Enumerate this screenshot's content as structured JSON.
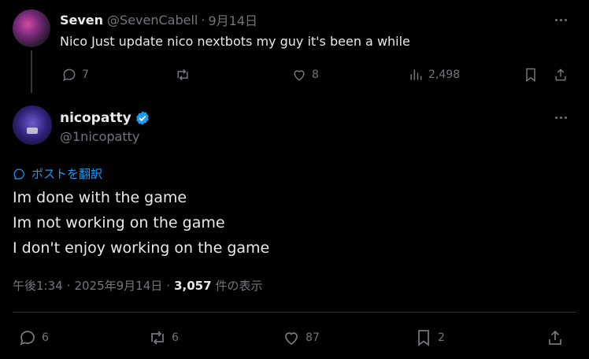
{
  "reply": {
    "name": "Seven",
    "handle": "@SevenCabell",
    "separator": "·",
    "date": "9月14日",
    "text": "Nico Just update nico nextbots my guy it's been a while",
    "actions": {
      "replies": "7",
      "reposts": "",
      "likes": "8",
      "views": "2,498"
    }
  },
  "post": {
    "name": "nicopatty",
    "handle": "@1nicopatty",
    "translate_label": "ポストを翻訳",
    "lines": [
      "Im done with the game",
      "Im not working on the game",
      "I don't enjoy working on the game"
    ],
    "time": "午後1:34",
    "sep1": "·",
    "date": "2025年9月14日",
    "sep2": "·",
    "view_count": "3,057",
    "view_label": "件の表示",
    "actions": {
      "replies": "6",
      "reposts": "6",
      "likes": "87",
      "bookmarks": "2"
    }
  },
  "colors": {
    "background": "#000000",
    "text": "#e7e9ea",
    "muted": "#71767b",
    "accent": "#1d9bf0",
    "divider": "#2f3336"
  },
  "icons": [
    "reply-icon",
    "repost-icon",
    "like-icon",
    "views-icon",
    "bookmark-icon",
    "share-icon",
    "verified-badge-icon",
    "translate-icon",
    "more-icon"
  ]
}
